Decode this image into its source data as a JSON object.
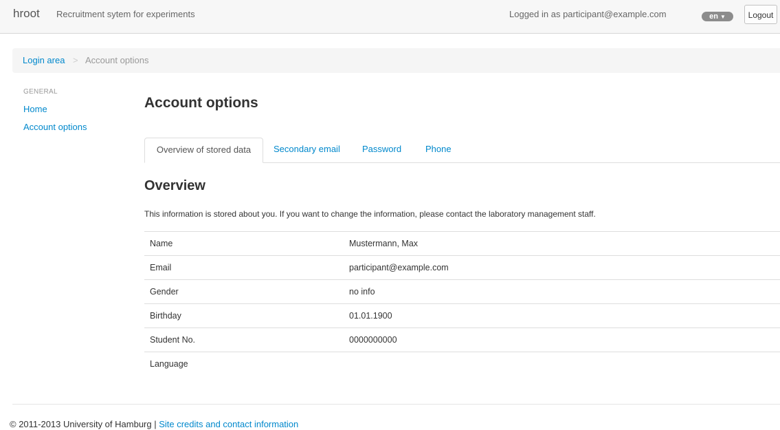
{
  "navbar": {
    "brand": "hroot",
    "tagline": "Recruitment sytem for experiments",
    "login_status": "Logged in as participant@example.com",
    "language": "en",
    "logout": "Logout"
  },
  "breadcrumb": {
    "home": "Login area",
    "separator": ">",
    "current": "Account options"
  },
  "sidebar": {
    "header": "GENERAL",
    "items": [
      {
        "label": "Home"
      },
      {
        "label": "Account options"
      }
    ]
  },
  "main": {
    "title": "Account options",
    "tabs": [
      {
        "label": "Overview of stored data",
        "active": true
      },
      {
        "label": "Secondary email",
        "active": false
      },
      {
        "label": "Password",
        "active": false
      },
      {
        "label": "Phone",
        "active": false
      }
    ],
    "section_title": "Overview",
    "intro": "This information is stored about you. If you want to change the information, please contact the laboratory management staff.",
    "rows": [
      {
        "field": "Name",
        "value": "Mustermann, Max"
      },
      {
        "field": "Email",
        "value": "participant@example.com"
      },
      {
        "field": "Gender",
        "value": "no info"
      },
      {
        "field": "Birthday",
        "value": "01.01.1900"
      },
      {
        "field": "Student No.",
        "value": "0000000000"
      },
      {
        "field": "Language",
        "value": ""
      }
    ]
  },
  "footer": {
    "copyright": "© 2011-2013 University of Hamburg |",
    "link": "Site credits and contact information"
  },
  "colors": {
    "link": "#0088cc",
    "navbar_bg": "#f7f7f7",
    "breadcrumb_bg": "#f5f5f5",
    "language_badge": "#8c8c8c"
  }
}
